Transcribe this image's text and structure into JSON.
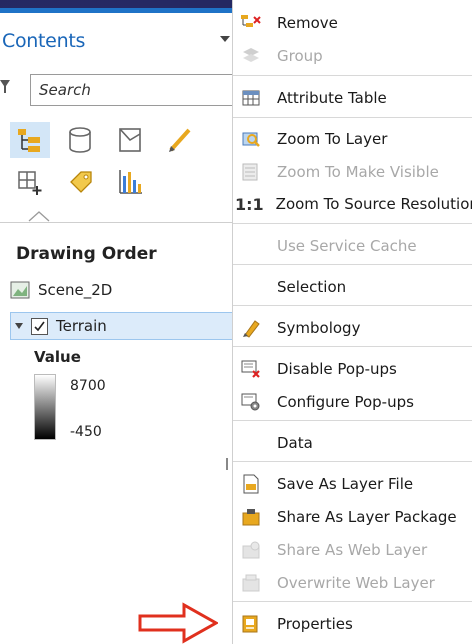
{
  "contents_pane": {
    "title": "Contents",
    "search_placeholder": "Search",
    "drawing_order_heading": "Drawing Order",
    "layers": [
      {
        "name": "Scene_2D"
      },
      {
        "name": "Terrain",
        "checked": true,
        "selected": true
      }
    ],
    "legend": {
      "label": "Value",
      "max": "8700",
      "min": "-450"
    },
    "toolbar_icons": [
      "list-by-drawing-order-icon",
      "list-by-source-icon",
      "list-by-selection-icon",
      "list-by-editing-icon",
      "list-by-snapping-icon",
      "list-by-labeling-icon",
      "list-by-charts-icon"
    ]
  },
  "context_menu": {
    "items": [
      {
        "label": "Remove",
        "icon": "remove-layer-icon",
        "enabled": true
      },
      {
        "label": "Group",
        "icon": "group-icon",
        "enabled": false
      },
      {
        "label": "Attribute Table",
        "icon": "table-icon",
        "enabled": true
      },
      {
        "label": "Zoom To Layer",
        "icon": "zoom-layer-icon",
        "enabled": true
      },
      {
        "label": "Zoom To Make Visible",
        "icon": "zoom-visible-icon",
        "enabled": false
      },
      {
        "label": "1:1",
        "label_full": "Zoom To Source Resolution",
        "icon": "one-to-one-icon",
        "enabled": true
      },
      {
        "label": "Use Service Cache",
        "enabled": false
      },
      {
        "label": "Selection",
        "enabled": true
      },
      {
        "label": "Symbology",
        "icon": "symbology-icon",
        "enabled": true
      },
      {
        "label": "Disable Pop-ups",
        "icon": "disable-popups-icon",
        "enabled": true
      },
      {
        "label": "Configure Pop-ups",
        "icon": "configure-popups-icon",
        "enabled": true
      },
      {
        "label": "Data",
        "enabled": true
      },
      {
        "label": "Save As Layer File",
        "icon": "layer-file-icon",
        "enabled": true
      },
      {
        "label": "Share As Layer Package",
        "icon": "layer-package-icon",
        "enabled": true
      },
      {
        "label": "Share As Web Layer",
        "icon": "web-layer-icon",
        "enabled": false
      },
      {
        "label": "Overwrite Web Layer",
        "icon": "overwrite-web-layer-icon",
        "enabled": false
      },
      {
        "label": "Properties",
        "icon": "properties-icon",
        "enabled": true
      }
    ]
  },
  "colors": {
    "accent": "#1f73c7",
    "background": "#2b2f6b",
    "arrow": "#e0301e"
  }
}
